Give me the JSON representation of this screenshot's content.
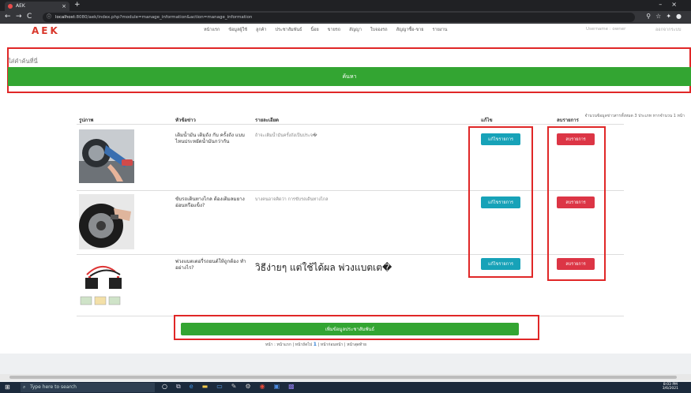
{
  "browser": {
    "tab_title": "AEK",
    "url_host": "localhost",
    "url_rest": ":8080/aek/index.php?module=manage_information&action=manage_information"
  },
  "site": {
    "logo": "AEK",
    "menu": [
      "หน้าแรก",
      "ข้อมูลผู้ใช้",
      "ลูกค้า",
      "ประชาสัมพันธ์",
      "นิ้อย",
      "ขายรถ",
      "สัญญา",
      "ใบจองรถ",
      "สัญญาซื้อ-ขาย",
      "รายงาน"
    ],
    "username": "Username : owner",
    "logout": "ออกจากระบบ"
  },
  "search": {
    "placeholder": "ใส่คำค้นที่นี่",
    "button": "ค้นหา"
  },
  "count_info": "จำนวนข้อมูลข่าวสารทั้งหมด 3 ประเภท หากจำนวน 1 หน้า",
  "table": {
    "headers": {
      "image": "รูปภาพ",
      "title": "หัวข้อข่าว",
      "detail": "รายละเอียด",
      "edit": "แก้ไข",
      "delete": "ลบรายการ"
    },
    "rows": [
      {
        "title": "เติมน้ำมัน เติมถัง กับ ครั้งถัง แบบไหนประหยัดน้ำมันกว่ากัน",
        "detail": "ถ้าจะเติมน้ำมันครั้งถังเป็นประจ�",
        "edit": "แก้ไขรายการ",
        "delete": "ลบรายการ"
      },
      {
        "title": "ขับรถเดินทางไกล ต้องเติมลมยางอ่อนหรือแข็ง?",
        "detail": "บางคนอาจคิดว่า การขับรถเดินทางไกล",
        "edit": "แก้ไขรายการ",
        "delete": "ลบรายการ"
      },
      {
        "title": "พ่วงแบตเตอรี่รถยนต์ให้ถูกต้อง ทำอย่างไร?",
        "detail": "วิธีง่ายๆ แต่ใช้ได้ผล พ่วงแบตเต�",
        "edit": "แก้ไขรายการ",
        "delete": "ลบรายการ"
      }
    ]
  },
  "add_button": "เพิ่มข้อมูลประชาสัมพันธ์",
  "pager": {
    "before": "หน้า : หน้าแรก | หน้าถัดไป",
    "current": "1",
    "after": "| หน้าก่อนหน้า | หน้าสุดท้าย"
  },
  "taskbar": {
    "search_placeholder": "Type here to search",
    "time": "8:03 PM",
    "date": "3/6/2021"
  }
}
